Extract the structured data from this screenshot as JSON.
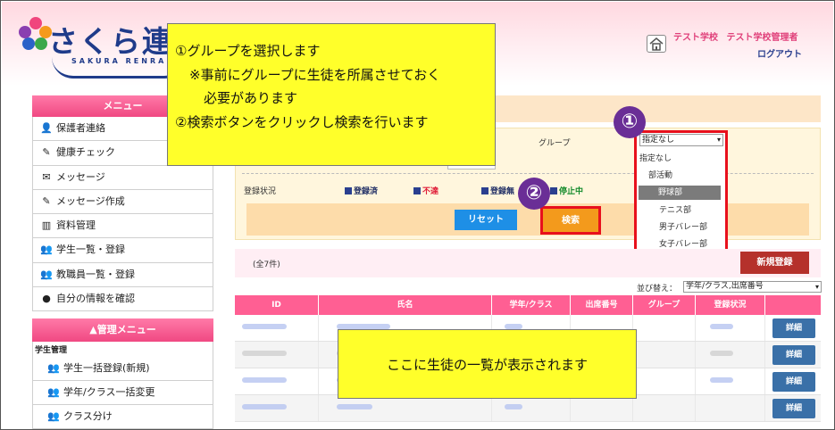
{
  "header": {
    "logo_text": "さくら連",
    "logo_sub": "SAKURA RENRA",
    "school": "テスト学校",
    "admin": "テスト学校管理者",
    "logout": "ログアウト"
  },
  "sidebar": {
    "menu_title": "メニュー",
    "items": [
      {
        "label": "保護者連絡",
        "icon": "👤"
      },
      {
        "label": "健康チェック",
        "icon": "✎"
      },
      {
        "label": "メッセージ",
        "icon": "✉"
      },
      {
        "label": "メッセージ作成",
        "icon": "✎"
      },
      {
        "label": "資料管理",
        "icon": "▥"
      },
      {
        "label": "学生一覧・登録",
        "icon": "👥"
      },
      {
        "label": "教職員一覧・登録",
        "icon": "👥"
      },
      {
        "label": "自分の情報を確認",
        "icon": "●"
      }
    ],
    "admin_title": "▲管理メニュー",
    "section_label": "学生管理",
    "admin_items": [
      {
        "label": "学生一括登録(新規)",
        "icon": "👥"
      },
      {
        "label": "学年/クラス一括変更",
        "icon": "👥"
      },
      {
        "label": "クラス分け",
        "icon": "👥"
      }
    ]
  },
  "search": {
    "group_label": "グループ",
    "group_value": "指定なし",
    "reg_label": "登録状況",
    "checks": [
      {
        "label": "登録済",
        "style": "blue"
      },
      {
        "label": "不達",
        "style": "red"
      },
      {
        "label": "登録無",
        "style": "blue"
      },
      {
        "label": "停止中",
        "style": "green"
      }
    ],
    "reset_label": "リセット",
    "search_label": "検索",
    "dropdown": [
      "指定なし",
      "部活動",
      "野球部",
      "テニス部",
      "男子バレー部",
      "女子バレー部"
    ],
    "dropdown_selected": "野球部"
  },
  "list": {
    "count": "(全7件)",
    "new_button": "新規登録",
    "sort_label": "並び替え：",
    "sort_value": "学年/クラス,出席番号",
    "headers": [
      "ID",
      "氏名",
      "学年/クラス",
      "出席番号",
      "グループ",
      "登録状況",
      ""
    ],
    "detail_label": "詳細"
  },
  "callouts": {
    "step1": "①グループを選択します",
    "step1_note1": "※事前にグループに生徒を所属させておく",
    "step1_note2": "必要があります",
    "step2": "②検索ボタンをクリックし検索を行います",
    "list_note": "ここに生徒の一覧が表示されます",
    "badge1": "①",
    "badge2": "②"
  },
  "colors": {
    "accent_pink": "#ff5f93",
    "callout_yellow": "#ffff2a",
    "highlight_red": "#e8101c",
    "badge_purple": "#6a2e96"
  }
}
